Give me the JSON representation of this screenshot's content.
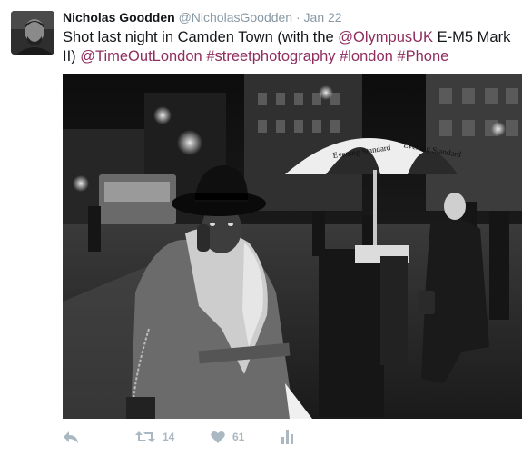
{
  "tweet": {
    "author_name": "Nicholas Goodden",
    "author_handle": "@NicholasGoodden",
    "separator": "·",
    "timestamp": "Jan 22",
    "text": {
      "part1": "Shot last night in Camden Town (with the ",
      "mention_olympus": "@OlympusUK",
      "part2": " E-M5 Mark II) ",
      "mention_timeout": "@TimeOutLondon",
      "hashtag_street": "#streetphotography",
      "hashtag_london": "#london",
      "hashtag_phone": "#Phone"
    },
    "photo": {
      "umbrella_text_left": "Evening Standard",
      "umbrella_text_right": "Evening Standard"
    },
    "actions": {
      "reply_icon": "reply-icon",
      "retweet_icon": "retweet-icon",
      "retweet_count": "14",
      "like_icon": "heart-icon",
      "like_count": "61",
      "analytics_icon": "analytics-icon"
    }
  },
  "colors": {
    "link": "#8e2d5e",
    "muted": "#8899a6",
    "action": "#aab8c2"
  }
}
